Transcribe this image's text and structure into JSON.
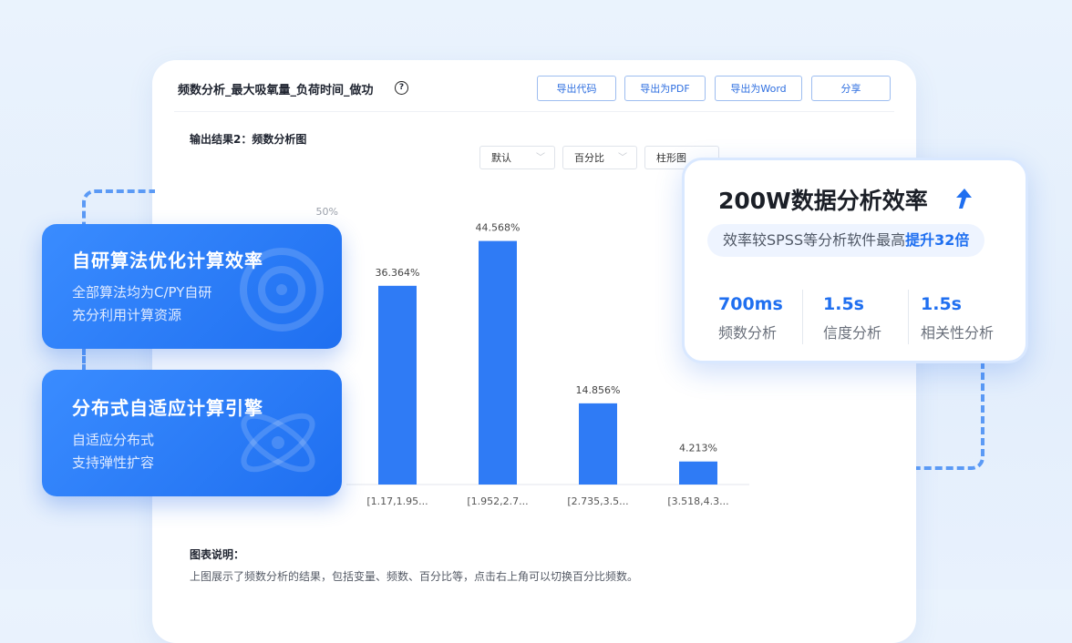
{
  "panel": {
    "title": "频数分析_最大吸氧量_负荷时间_做功",
    "help_icon": "?",
    "buttons": [
      "导出代码",
      "导出为PDF",
      "导出为Word",
      "分享"
    ],
    "subtitle": "输出结果2：频数分析图",
    "selects": [
      "默认",
      "百分比",
      "柱形图"
    ],
    "description_title": "图表说明：",
    "description": "上图展示了频数分析的结果，包括变量、频数、百分比等，点击右上角可以切换百分比频数。"
  },
  "chart_data": {
    "type": "bar",
    "categories": [
      "[1.17,1.95...",
      "[1.952,2.7...",
      "[2.735,3.5...",
      "[3.518,4.3..."
    ],
    "values": [
      36.364,
      44.568,
      14.856,
      4.213
    ],
    "value_labels": [
      "36.364%",
      "44.568%",
      "14.856%",
      "4.213%"
    ],
    "y_ticks": [
      "50%"
    ],
    "ylim": [
      0,
      50
    ],
    "bar_color": "#2f7bf5"
  },
  "cards": [
    {
      "title": "自研算法优化计算效率",
      "lines": [
        "全部算法均为C/PY自研",
        "充分利用计算资源"
      ],
      "icon": "target-icon"
    },
    {
      "title": "分布式自适应计算引擎",
      "lines": [
        "自适应分布式",
        "支持弹性扩容"
      ],
      "icon": "atom-icon"
    }
  ],
  "stats": {
    "title": "200W数据分析效率",
    "pill_text": "效率较SPSS等分析软件最高",
    "pill_highlight": "提升32倍",
    "items": [
      {
        "value": "700ms",
        "label": "频数分析"
      },
      {
        "value": "1.5s",
        "label": "信度分析"
      },
      {
        "value": "1.5s",
        "label": "相关性分析"
      }
    ]
  },
  "colors": {
    "accent": "#1f6ff0",
    "card": "#2a7dfa",
    "background": "#e6f0fc"
  }
}
